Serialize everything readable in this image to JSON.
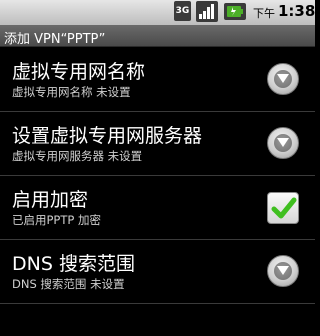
{
  "status_bar": {
    "network_label": "3G",
    "ampm": "下午",
    "time": "1:38",
    "icons": [
      "3g-icon",
      "signal-icon",
      "battery-icon"
    ]
  },
  "title_bar": {
    "title": "添加 VPN“PPTP”"
  },
  "preferences": [
    {
      "title": "虚拟专用网名称",
      "summary": "虚拟专用网名称 未设置",
      "widget": "dropdown"
    },
    {
      "title": "设置虚拟专用网服务器",
      "summary": "虚拟专用网服务器 未设置",
      "widget": "dropdown"
    },
    {
      "title": "启用加密",
      "summary": "已启用PPTP 加密",
      "widget": "checkbox",
      "checked": true
    },
    {
      "title": "DNS 搜索范围",
      "summary": "DNS 搜索范围 未设置",
      "widget": "dropdown"
    }
  ],
  "colors": {
    "background": "#000000",
    "check_green": "#3fbf1f",
    "battery_green": "#4caf28"
  }
}
